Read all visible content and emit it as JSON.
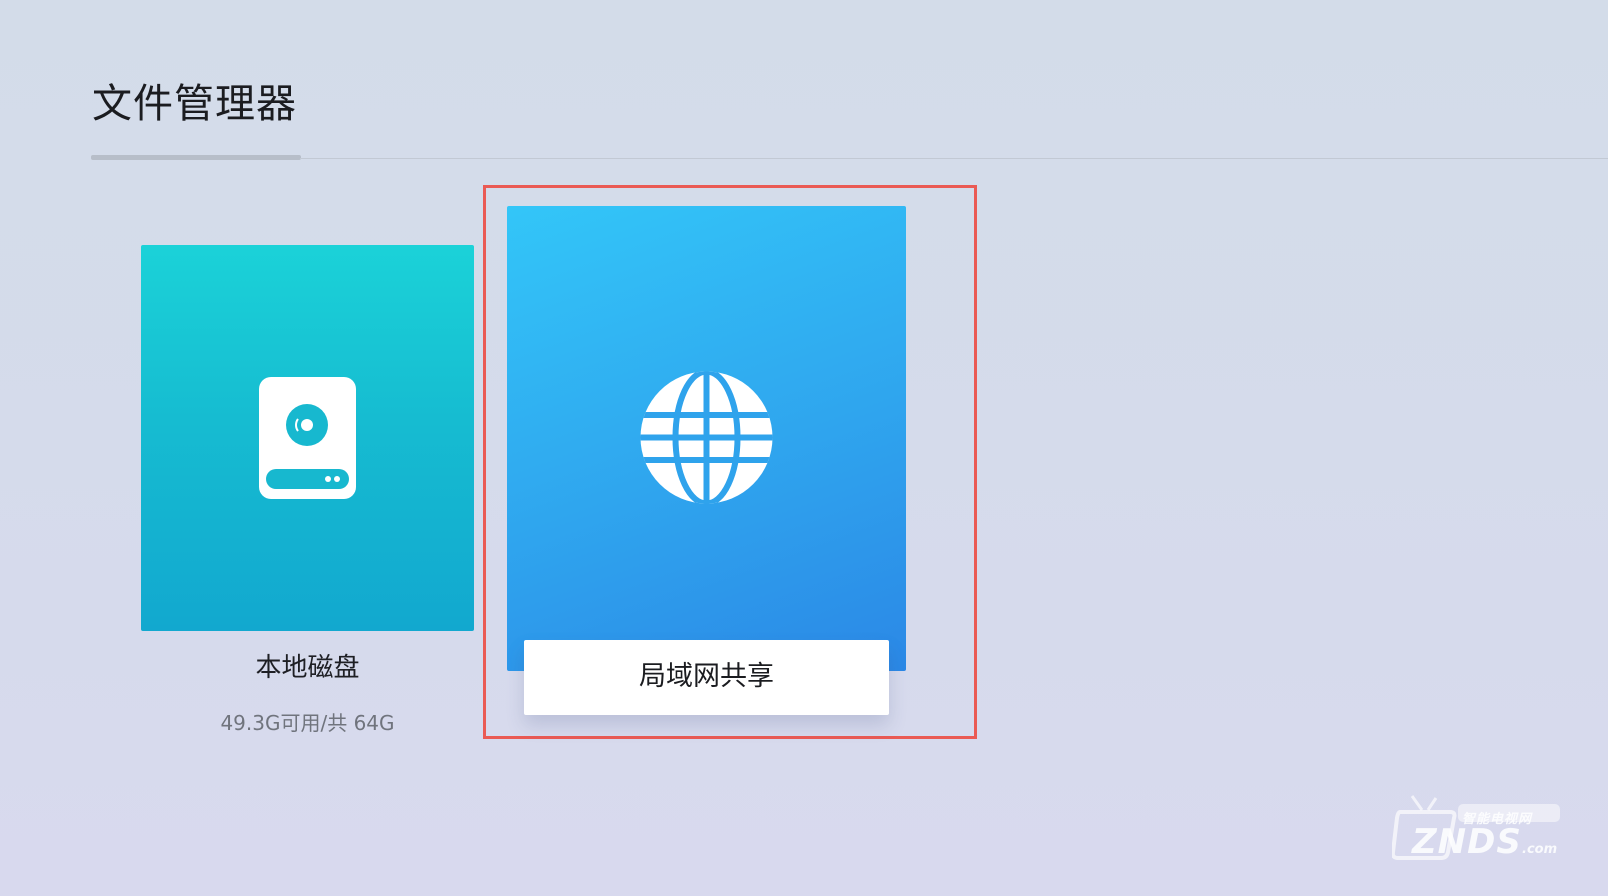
{
  "header": {
    "title": "文件管理器"
  },
  "cards": {
    "local_disk": {
      "label": "本地磁盘",
      "storage": "49.3G可用/共 64G",
      "icon": "hard-disk-icon",
      "color": "#16bcd1"
    },
    "lan_share": {
      "label": "局域网共享",
      "icon": "globe-icon",
      "color": "#2fa5ee",
      "selected": true
    }
  },
  "highlight": {
    "color": "#ea5a54"
  },
  "watermark": {
    "sub": "智能电视网",
    "main": "ZNDS",
    "domain": ".com"
  }
}
